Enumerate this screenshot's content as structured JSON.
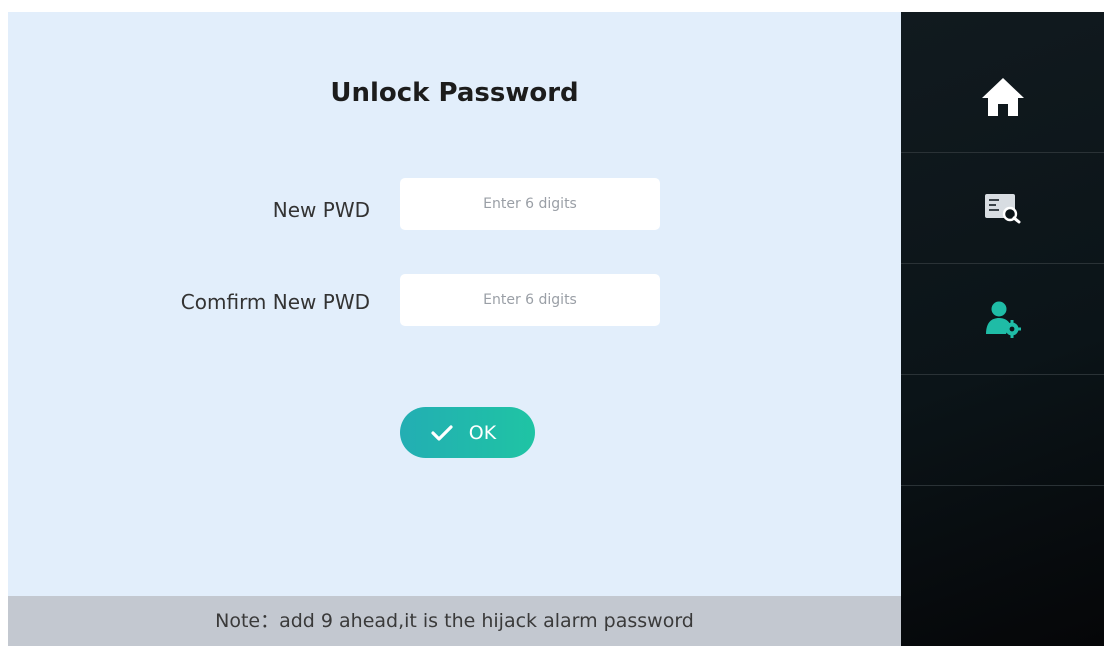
{
  "page": {
    "title": "Unlock Password"
  },
  "form": {
    "new_pwd_label": "New PWD",
    "new_pwd_placeholder": "Enter 6 digits",
    "new_pwd_value": "",
    "confirm_pwd_label": "Comfirm New PWD",
    "confirm_pwd_placeholder": "Enter 6 digits",
    "confirm_pwd_value": "",
    "ok_label": "OK"
  },
  "note": {
    "text": "Note：add 9 ahead,it is the hijack alarm password"
  },
  "sidebar": {
    "items": [
      {
        "icon": "home-icon"
      },
      {
        "icon": "record-search-icon"
      },
      {
        "icon": "user-settings-icon"
      },
      {
        "icon": ""
      }
    ]
  },
  "colors": {
    "main_bg": "#e2eefb",
    "accent_start": "#23aeb3",
    "accent_end": "#1fc4a4",
    "sidebar_bg": "#0b1418",
    "note_bg": "#c3c8d0"
  }
}
